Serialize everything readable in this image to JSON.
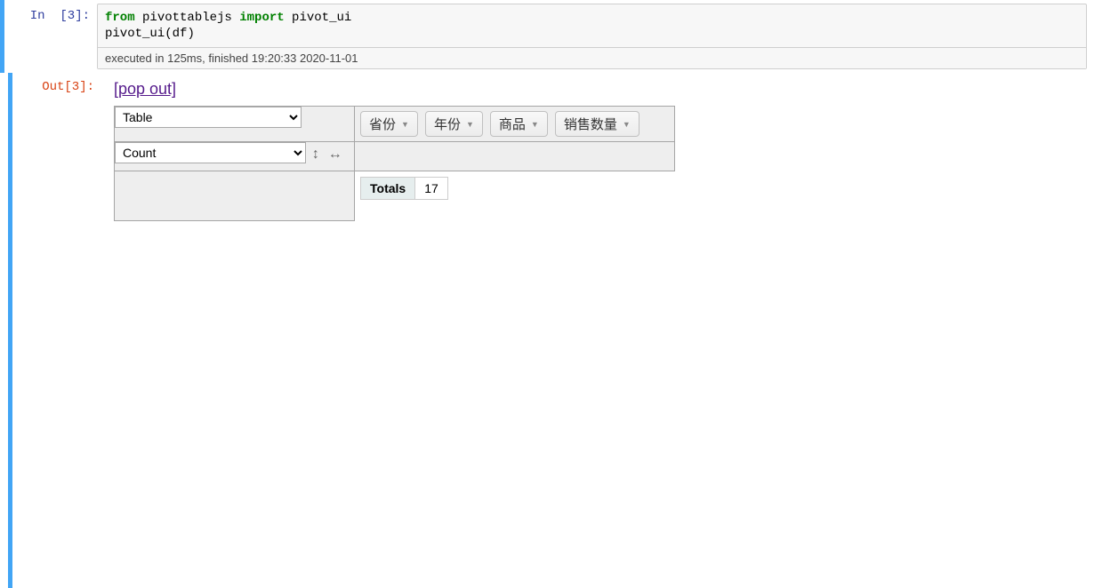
{
  "input": {
    "prompt": "In  [3]:",
    "code_kw_from": "from",
    "code_mod": " pivottablejs ",
    "code_kw_import": "import",
    "code_name": " pivot_ui",
    "code_line2a": "pivot_ui",
    "code_line2_paren_open": "(",
    "code_line2_var": "df",
    "code_line2_paren_close": ")",
    "exec_info": "executed in 125ms, finished 19:20:33 2020-11-01"
  },
  "output": {
    "prompt": "Out[3]:",
    "popout": "[pop out]",
    "renderer": "Table",
    "aggregator": "Count",
    "unused_attrs": [
      "省份",
      "年份",
      "商品",
      "销售数量"
    ],
    "result": {
      "totals_label": "Totals",
      "totals_value": "17"
    }
  }
}
